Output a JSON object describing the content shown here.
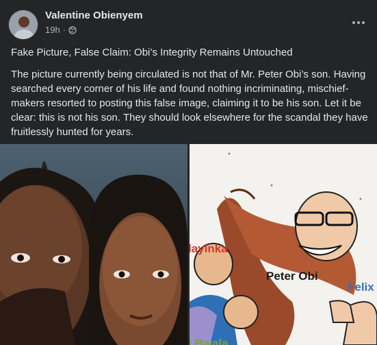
{
  "post": {
    "author": "Valentine Obienyem",
    "time": "19h",
    "separator": "·",
    "privacy_icon": "globe-icon",
    "more_icon": "more-horizontal-icon",
    "headline": "Fake Picture, False Claim: Obi’s Integrity Remains Untouched",
    "body": "The picture currently being circulated is not that of Mr. Peter Obi’s son. Having searched every corner of his life and found nothing incriminating, mischief-makers resorted to posting this false image, claiming it to be his son. Let it be clear: this is not his son. They should look elsewhere for the scandal they have fruitlessly hunted for years."
  },
  "cartoon": {
    "label_left": "layinka",
    "label_center": "Peter Obi",
    "label_right": "Felix",
    "label_bottom": "I Bwala"
  },
  "colors": {
    "background": "#242526",
    "text_primary": "#e4e6eb",
    "text_secondary": "#b0b3b8"
  }
}
